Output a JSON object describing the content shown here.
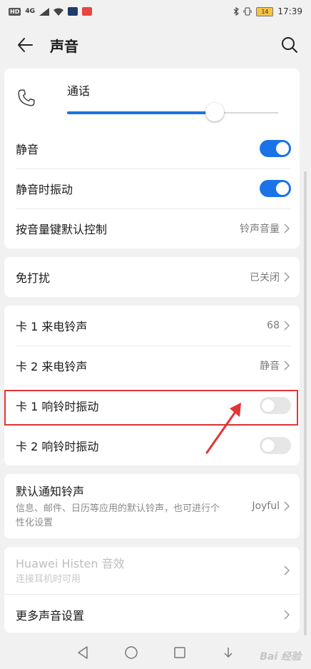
{
  "status_bar": {
    "left_badge": "HD",
    "signal": "4G",
    "time": "17:39",
    "battery_level": "14"
  },
  "header": {
    "title": "声音"
  },
  "call_volume": {
    "label": "通话",
    "level": 0.7
  },
  "group_mute": [
    {
      "label": "静音",
      "toggle": true
    },
    {
      "label": "静音时振动",
      "toggle": true
    },
    {
      "label": "按音量键默认控制",
      "value": "铃声音量"
    }
  ],
  "dnd": {
    "label": "免打扰",
    "value": "已关闭"
  },
  "group_sim": [
    {
      "label": "卡 1 来电铃声",
      "value": "68"
    },
    {
      "label": "卡 2 来电铃声",
      "value": "静音"
    },
    {
      "label": "卡 1 响铃时振动",
      "toggle": false
    },
    {
      "label": "卡 2 响铃时振动",
      "toggle": false
    }
  ],
  "notify": {
    "label": "默认通知铃声",
    "sub": "信息、邮件、日历等应用的默认铃声，也可进行个性化设置",
    "value": "Joyful"
  },
  "histen": {
    "label": "Huawei Histen 音效",
    "sub": "连接耳机时可用"
  },
  "more": {
    "label": "更多声音设置"
  },
  "watermark": "Bai 经验",
  "colors": {
    "accent": "#1a73e8",
    "highlight": "#e03636"
  }
}
